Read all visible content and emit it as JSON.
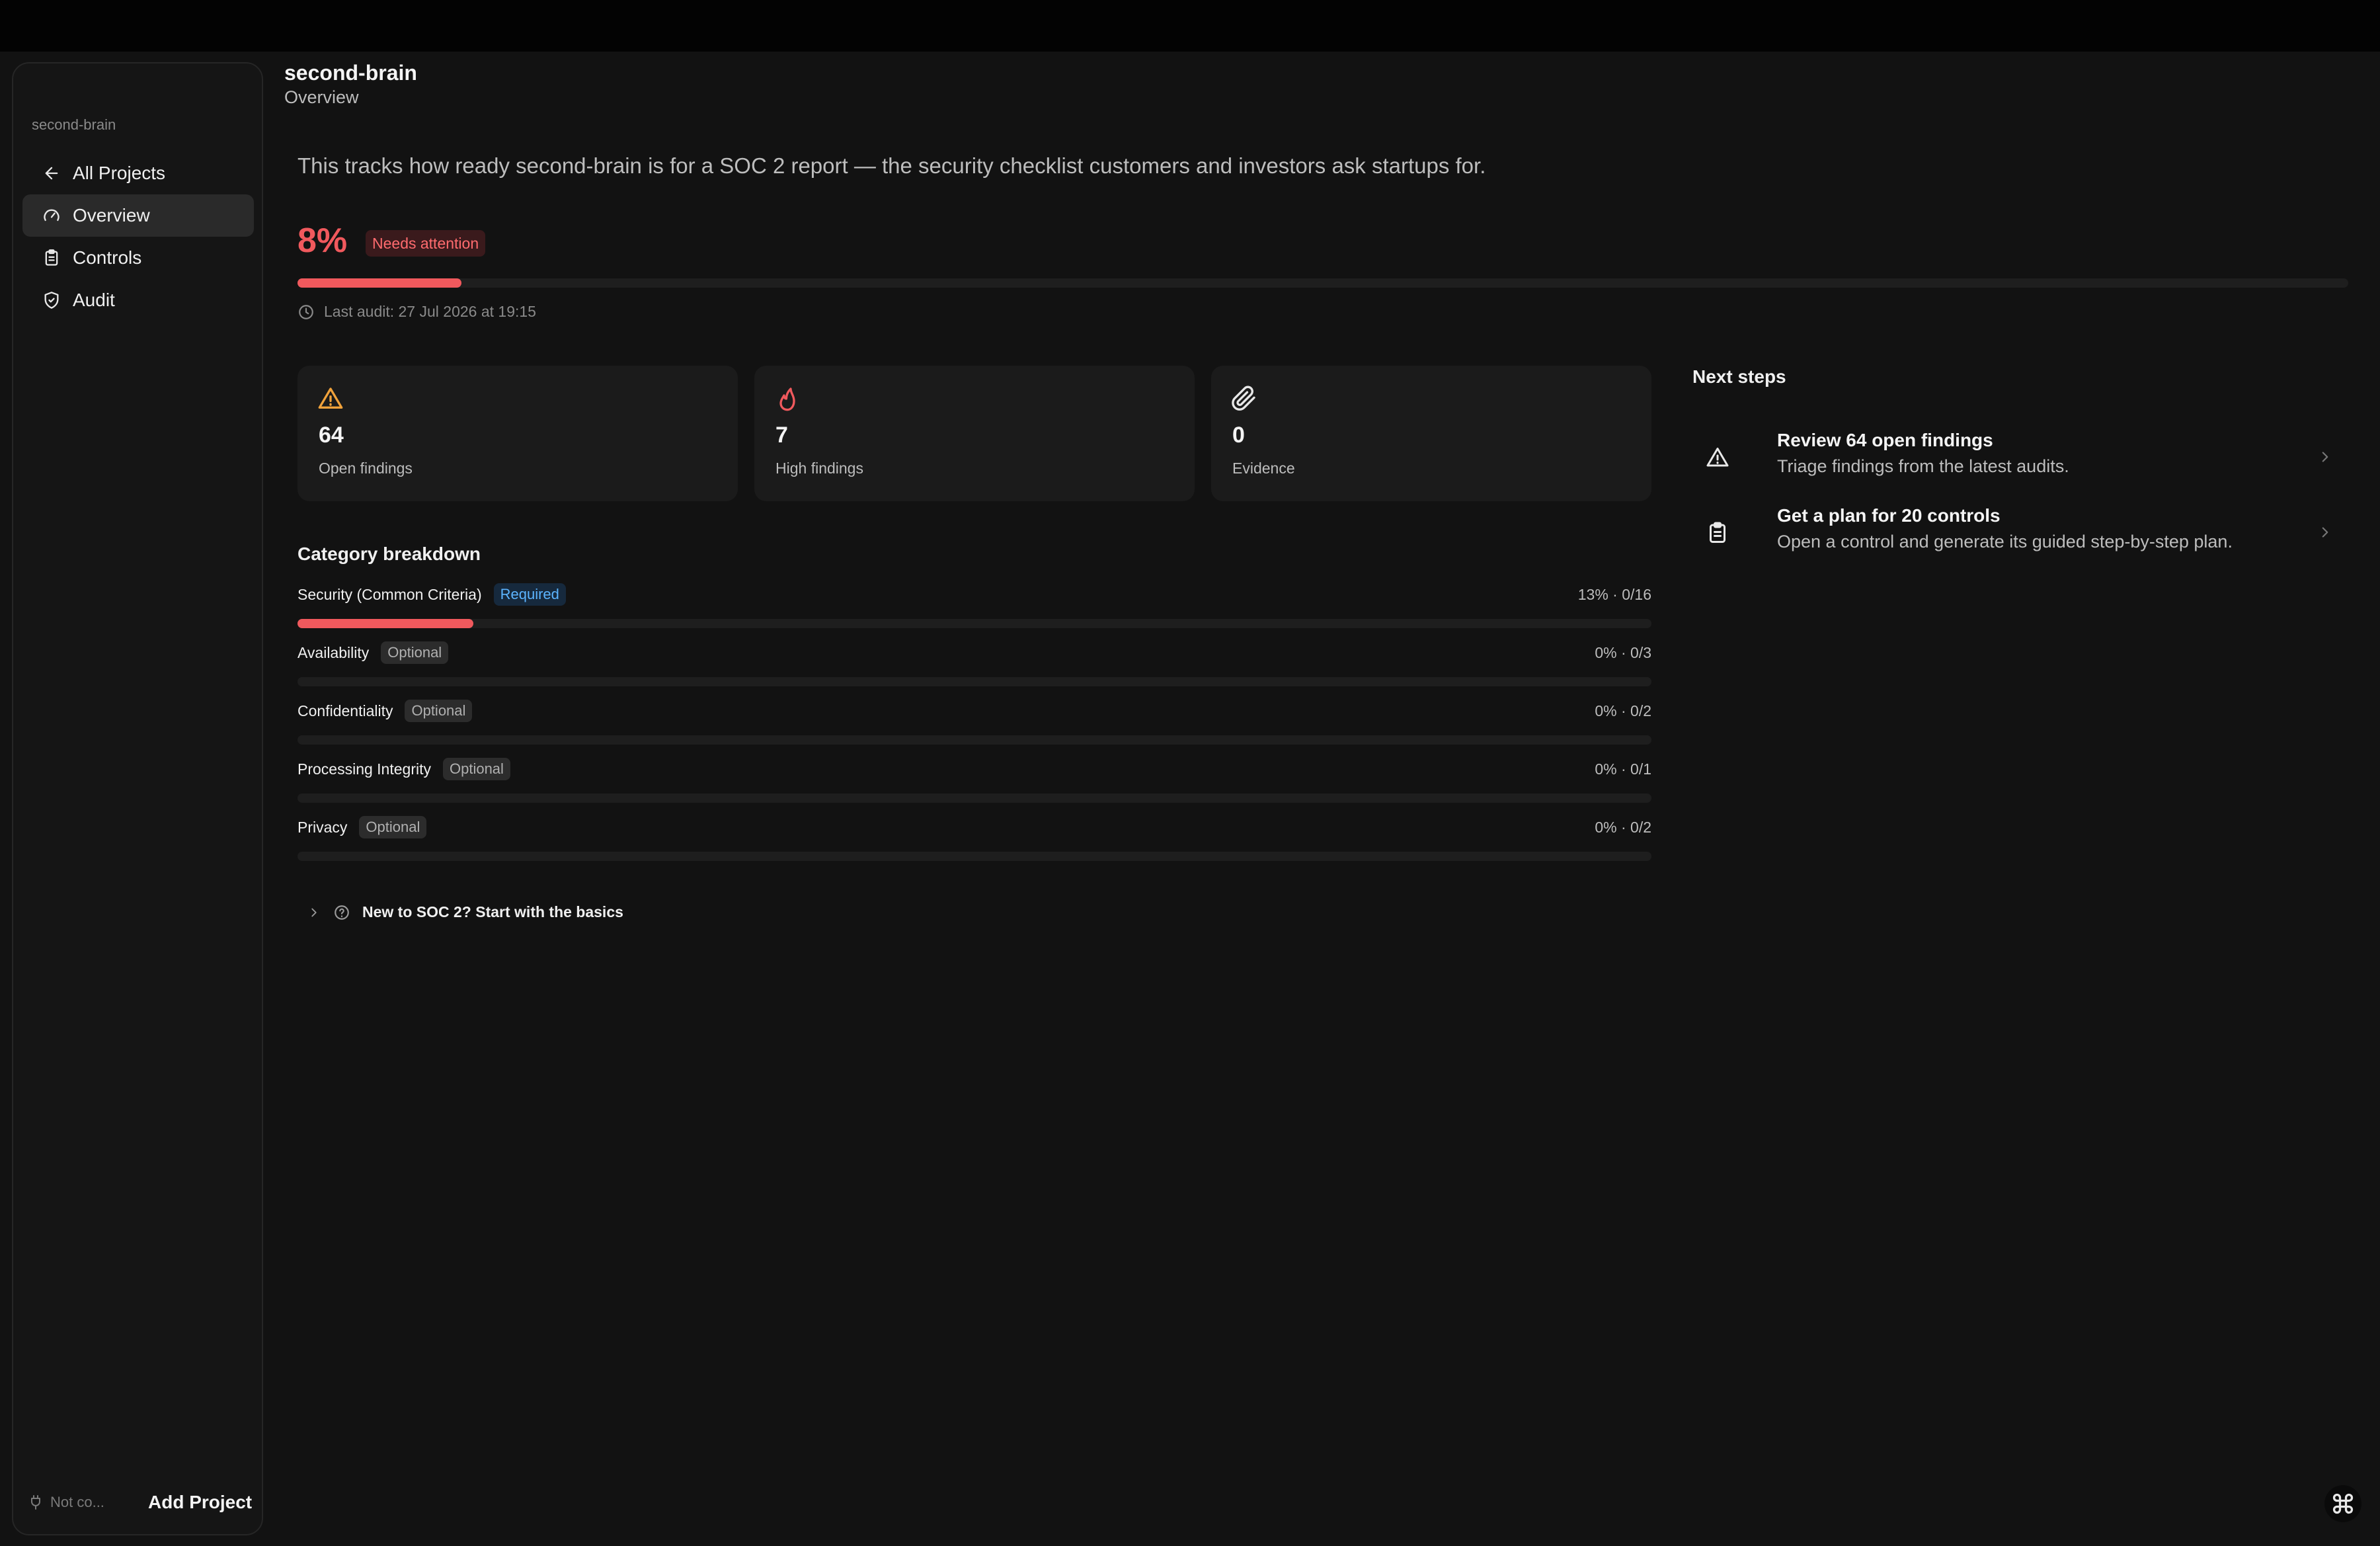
{
  "sidebar": {
    "project": "second-brain",
    "items": [
      {
        "label": "All Projects",
        "icon": "arrow-left-icon"
      },
      {
        "label": "Overview",
        "icon": "gauge-icon"
      },
      {
        "label": "Controls",
        "icon": "clipboard-icon"
      },
      {
        "label": "Audit",
        "icon": "shield-check-icon"
      }
    ],
    "status": "Not co...",
    "add_project": "Add Project"
  },
  "header": {
    "title": "second-brain",
    "subtitle": "Overview"
  },
  "intro": "This tracks how ready second-brain is for a SOC 2 report — the security checklist customers and investors ask startups for.",
  "readiness": {
    "score": "8%",
    "progress": 0.08,
    "status_badge": "Needs attention",
    "last_audit": "Last audit: 27 Jul 2026 at 19:15"
  },
  "stats": [
    {
      "value": "64",
      "label": "Open findings",
      "icon": "warning-icon",
      "color": "#f0a23b"
    },
    {
      "value": "7",
      "label": "High findings",
      "icon": "flame-icon",
      "color": "#f0595d"
    },
    {
      "value": "0",
      "label": "Evidence",
      "icon": "paperclip-icon",
      "color": "#e8e8e8"
    }
  ],
  "categories": {
    "title": "Category breakdown",
    "items": [
      {
        "name": "Security (Common Criteria)",
        "badge": "Required",
        "stat": "13% · 0/16",
        "progress": 0.13
      },
      {
        "name": "Availability",
        "badge": "Optional",
        "stat": "0% · 0/3",
        "progress": 0
      },
      {
        "name": "Confidentiality",
        "badge": "Optional",
        "stat": "0% · 0/2",
        "progress": 0
      },
      {
        "name": "Processing Integrity",
        "badge": "Optional",
        "stat": "0% · 0/1",
        "progress": 0
      },
      {
        "name": "Privacy",
        "badge": "Optional",
        "stat": "0% · 0/2",
        "progress": 0
      }
    ]
  },
  "basics": "New to SOC 2? Start with the basics",
  "next_steps": {
    "title": "Next steps",
    "items": [
      {
        "title": "Review 64 open findings",
        "desc": "Triage findings from the latest audits.",
        "icon": "warning-icon"
      },
      {
        "title": "Get a plan for 20 controls",
        "desc": "Open a control and generate its guided step-by-step plan.",
        "icon": "clipboard-icon"
      }
    ]
  },
  "colors": {
    "accent_red": "#f0595d",
    "required_blue": "#5cb4ff",
    "warning_orange": "#f0a23b"
  }
}
